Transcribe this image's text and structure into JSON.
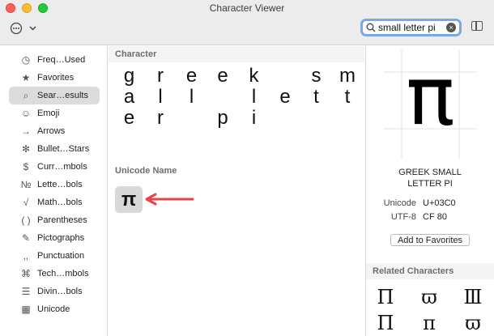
{
  "window": {
    "title": "Character Viewer"
  },
  "search": {
    "value": "small letter pi",
    "clear_glyph": "×"
  },
  "icons": {
    "action": "ellipsis-circle-icon",
    "chevron": "chevron-down-icon",
    "search": "magnifier-icon",
    "sidebar": "sidebar-toggle-icon"
  },
  "sidebar": {
    "items": [
      {
        "label": "Freq…Used",
        "icon": "clock-icon",
        "glyph": "◷"
      },
      {
        "label": "Favorites",
        "icon": "star-icon",
        "glyph": "★"
      },
      {
        "label": "Sear…esults",
        "icon": "magnifier-icon",
        "glyph": "⌕"
      },
      {
        "label": "Emoji",
        "icon": "smiley-icon",
        "glyph": "☺"
      },
      {
        "label": "Arrows",
        "icon": "arrow-right-icon",
        "glyph": "→"
      },
      {
        "label": "Bullet…Stars",
        "icon": "asterisk-icon",
        "glyph": "✻"
      },
      {
        "label": "Curr…mbols",
        "icon": "dollar-icon",
        "glyph": "$"
      },
      {
        "label": "Lette…bols",
        "icon": "numero-icon",
        "glyph": "№"
      },
      {
        "label": "Math…bols",
        "icon": "sqrt-icon",
        "glyph": "√"
      },
      {
        "label": "Parentheses",
        "icon": "parentheses-icon",
        "glyph": "( )"
      },
      {
        "label": "Pictographs",
        "icon": "pictograph-icon",
        "glyph": "✎"
      },
      {
        "label": "Punctuation",
        "icon": "punctuation-icon",
        "glyph": "‚,"
      },
      {
        "label": "Tech…mbols",
        "icon": "command-icon",
        "glyph": "⌘"
      },
      {
        "label": "Divin…bols",
        "icon": "trigram-icon",
        "glyph": "☰"
      },
      {
        "label": "Unicode",
        "icon": "table-icon",
        "glyph": "▦"
      }
    ]
  },
  "main": {
    "character_header": "Character",
    "unicode_name_header": "Unicode Name",
    "characters": [
      [
        "g",
        "r",
        "e",
        "e",
        "k",
        "",
        "s",
        "m"
      ],
      [
        "a",
        "l",
        "l",
        "",
        "l",
        "e",
        "t",
        "t"
      ],
      [
        "e",
        "r",
        "",
        "p",
        "i",
        "",
        "",
        ""
      ]
    ],
    "result": "π"
  },
  "detail": {
    "glyph": "π",
    "name": "GREEK SMALL LETTER PI",
    "unicode_label": "Unicode",
    "unicode_value": "U+03C0",
    "utf8_label": "UTF-8",
    "utf8_value": "CF 80",
    "favorites_button": "Add to Favorites",
    "related_header": "Related Characters",
    "related": [
      [
        "Π",
        "ϖ",
        "Ⅲ"
      ],
      [
        "Π",
        "π",
        "ϖ"
      ]
    ]
  },
  "colors": {
    "accent": "#7aa7e8",
    "arrow": "#e8424a",
    "selected": "#dcdcdc"
  }
}
